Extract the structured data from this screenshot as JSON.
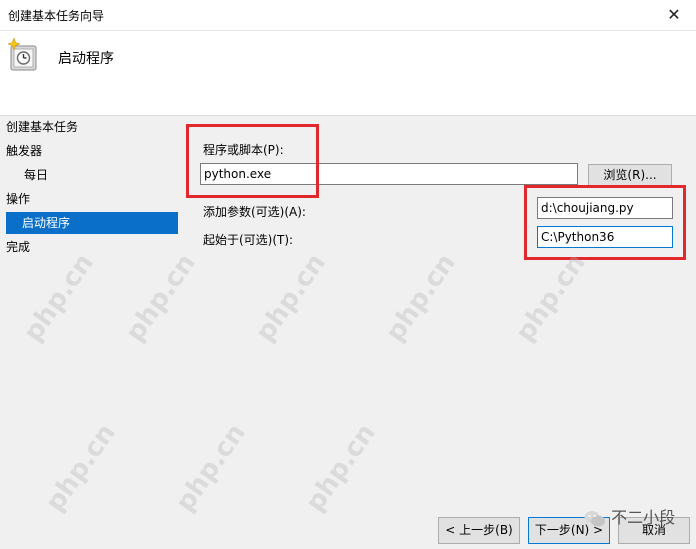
{
  "window": {
    "title": "创建基本任务向导",
    "close_glyph": "✕"
  },
  "header": {
    "title": "启动程序",
    "icon": "clock-task-icon"
  },
  "sidebar": {
    "items": [
      {
        "label": "创建基本任务"
      },
      {
        "label": "触发器"
      },
      {
        "label": "每日"
      },
      {
        "label": "操作"
      },
      {
        "label": "启动程序"
      },
      {
        "label": "完成"
      }
    ]
  },
  "form": {
    "program_label": "程序或脚本(P):",
    "program_value": "python.exe",
    "browse_label": "浏览(R)...",
    "args_label": "添加参数(可选)(A):",
    "args_value": "d:\\choujiang.py",
    "start_label": "起始于(可选)(T):",
    "start_value": "C:\\Python36"
  },
  "footer": {
    "back_label": "< 上一步(B)",
    "next_label": "下一步(N) >",
    "cancel_label": "取消"
  },
  "watermark": {
    "text": "php.cn"
  },
  "wechat_mark": {
    "text": "不二小段"
  },
  "colors": {
    "highlight": "#0a6fc9",
    "annotation": "#e0282d",
    "focus": "#0078d7"
  }
}
